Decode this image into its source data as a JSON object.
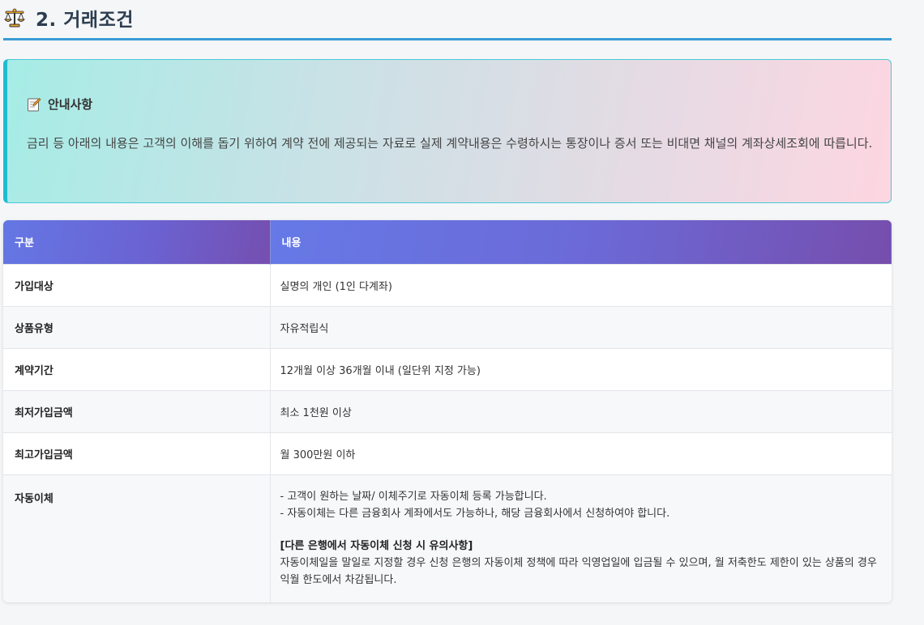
{
  "section": {
    "icon": "balance-scale-icon",
    "title": "2. 거래조건"
  },
  "notice": {
    "icon": "memo-icon",
    "title": "안내사항",
    "text": "금리 등 아래의 내용은 고객의 이해를 돕기 위하여 계약 전에 제공되는 자료로 실제 계약내용은 수령하시는 통장이나 증서 또는 비대면 채널의 계좌상세조회에 따릅니다."
  },
  "table": {
    "headers": [
      "구분",
      "내용"
    ],
    "rows": [
      {
        "label": "가입대상",
        "value": "실명의 개인 (1인 다계좌)"
      },
      {
        "label": "상품유형",
        "value": "자유적립식"
      },
      {
        "label": "계약기간",
        "value": "12개월 이상 36개월 이내 (일단위 지정 가능)"
      },
      {
        "label": "최저가입금액",
        "value": "최소 1천원 이상"
      },
      {
        "label": "최고가입금액",
        "value": "월 300만원 이하"
      },
      {
        "label": "자동이체",
        "lines": [
          "- 고객이 원하는 날짜/ 이체주기로 자동이체 등록 가능합니다.",
          "- 자동이체는 다른 금융회사 계좌에서도 가능하나, 해당 금융회사에서 신청하여야 합니다."
        ],
        "notice_title": "[다른 은행에서 자동이체 신청 시 유의사항]",
        "notice_text": "자동이체일을 말일로 지정할 경우 신청 은행의 자동이체 정책에 따라 익영업일에 입금될 수 있으며, 월 저축한도 제한이 있는 상품의 경우 익월 한도에서 차감됩니다."
      }
    ]
  },
  "colors": {
    "accent": "#3a9bd5",
    "header_gradient_start": "#6477e4",
    "header_gradient_end": "#754fb0",
    "notice_border": "#1fbcd0"
  }
}
